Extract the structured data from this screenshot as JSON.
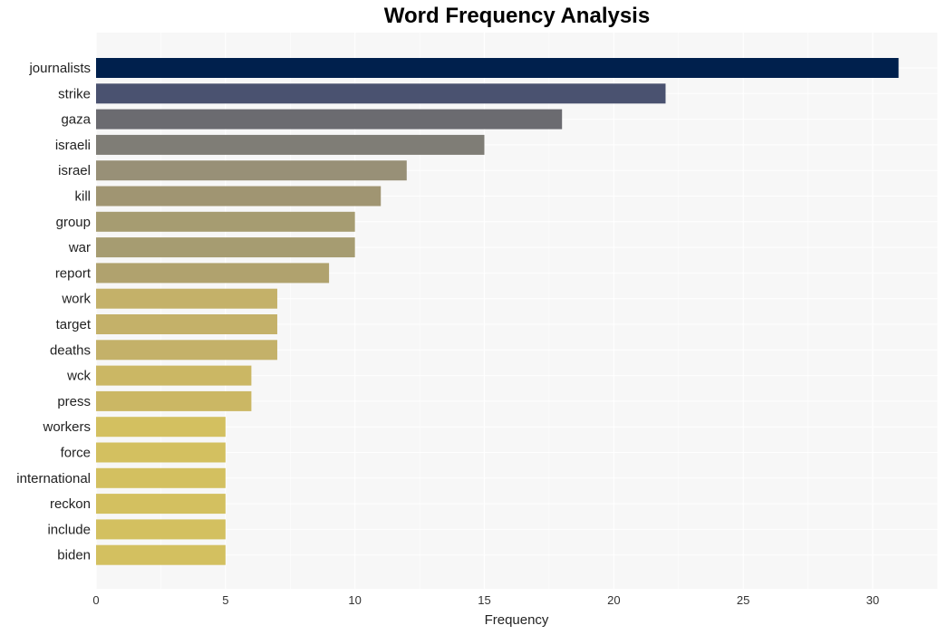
{
  "chart_data": {
    "type": "bar",
    "orientation": "horizontal",
    "title": "Word Frequency Analysis",
    "xlabel": "Frequency",
    "ylabel": "",
    "xlim": [
      0,
      32.5
    ],
    "xticks": [
      0,
      5,
      10,
      15,
      20,
      25,
      30
    ],
    "grid": true,
    "categories": [
      "journalists",
      "strike",
      "gaza",
      "israeli",
      "israel",
      "kill",
      "group",
      "war",
      "report",
      "work",
      "target",
      "deaths",
      "wck",
      "press",
      "workers",
      "force",
      "international",
      "reckon",
      "include",
      "biden"
    ],
    "values": [
      31,
      22,
      18,
      15,
      12,
      11,
      10,
      10,
      9,
      7,
      7,
      7,
      6,
      6,
      5,
      5,
      5,
      5,
      5,
      5
    ],
    "colors": [
      "#00204d",
      "#4a5270",
      "#6b6b70",
      "#7f7d76",
      "#989077",
      "#a09572",
      "#a69c71",
      "#a69c71",
      "#b0a26e",
      "#c4b169",
      "#c4b169",
      "#c4b169",
      "#cbb764",
      "#cbb764",
      "#d3c060",
      "#d3c060",
      "#d3c060",
      "#d3c060",
      "#d3c060",
      "#d3c060"
    ],
    "plot_background": "#f7f7f7"
  }
}
